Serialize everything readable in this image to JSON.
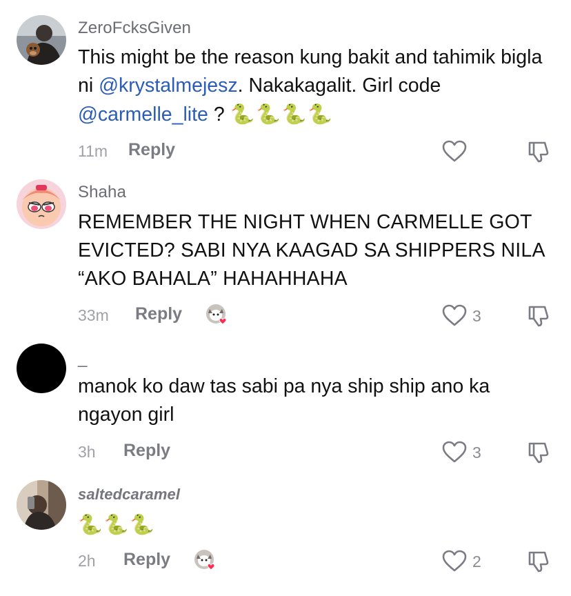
{
  "comments": [
    {
      "username": "ZeroFcksGiven",
      "text_parts": [
        "This might be the reason kung bakit and tahimik bigla ni ",
        "@krystalmejesz",
        ". Nakakagalit. Girl code ",
        "@carmelle_lite",
        " ? ",
        "🐍🐍🐍🐍"
      ],
      "time": "11m",
      "reply": "Reply",
      "likes": ""
    },
    {
      "username": "Shaha",
      "text": "REMEMBER THE NIGHT WHEN CARMELLE GOT EVICTED? SABI NYA KAAGAD SA SHIPPERS NILA “AKO BAHALA” HAHAHHAHA",
      "time": "33m",
      "reply": "Reply",
      "likes": "3"
    },
    {
      "username": "_",
      "text": "manok ko daw tas sabi pa nya ship ship ano ka ngayon girl",
      "time": "3h",
      "reply": "Reply",
      "likes": "3"
    },
    {
      "username": "saltedcaramel",
      "text": "🐍🐍🐍",
      "time": "2h",
      "reply": "Reply",
      "likes": "2"
    }
  ],
  "icons": {
    "like": "heart-outline-icon",
    "dislike": "thumbs-down-outline-icon",
    "creator_liked": "creator-liked-badge-icon"
  },
  "colors": {
    "mention": "#2b5db6",
    "username": "#6b6c74",
    "meta": "#a0a1a7",
    "heart_badge": "#fe2c55"
  }
}
